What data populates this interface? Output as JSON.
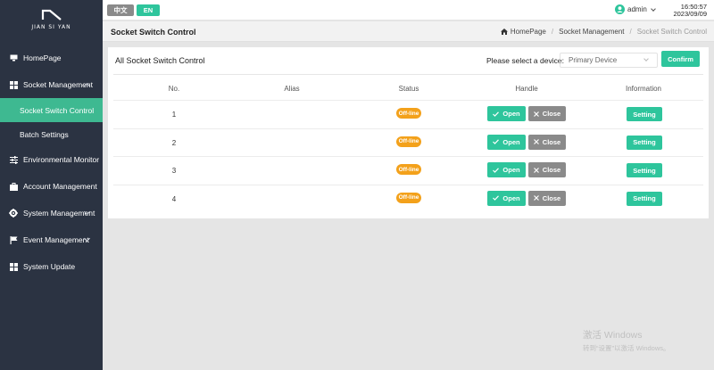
{
  "brand": {
    "logo_text": "JIAN SI YAN"
  },
  "sidebar": {
    "items": [
      {
        "label": "HomePage",
        "icon": "monitor-icon"
      },
      {
        "label": "Socket Management",
        "icon": "grid-icon",
        "expanded": true,
        "children": [
          {
            "label": "Socket Switch Control",
            "active": true
          },
          {
            "label": "Batch Settings"
          }
        ]
      },
      {
        "label": "Environmental Monitor",
        "icon": "sliders-icon"
      },
      {
        "label": "Account Management",
        "icon": "briefcase-icon"
      },
      {
        "label": "System Management",
        "icon": "gear-icon"
      },
      {
        "label": "Event Management",
        "icon": "flag-icon"
      },
      {
        "label": "System Update",
        "icon": "grid-icon"
      }
    ]
  },
  "topbar": {
    "lang_zh": "中文",
    "lang_en": "EN",
    "user": "admin",
    "time": "16:50:57",
    "date": "2023/09/09"
  },
  "header": {
    "title": "Socket Switch Control",
    "breadcrumb": [
      "HomePage",
      "Socket Management",
      "Socket Switch Control"
    ]
  },
  "card": {
    "title": "All Socket Switch Control",
    "device_label": "Please select a device:",
    "device_selected": "Primary Device",
    "confirm_label": "Confirm"
  },
  "table": {
    "columns": [
      "No.",
      "Alias",
      "Status",
      "Handle",
      "Information"
    ],
    "rows": [
      {
        "no": "1",
        "alias": "",
        "status": "Off-line"
      },
      {
        "no": "2",
        "alias": "",
        "status": "Off-line"
      },
      {
        "no": "3",
        "alias": "",
        "status": "Off-line"
      },
      {
        "no": "4",
        "alias": "",
        "status": "Off-line"
      }
    ],
    "open_label": "Open",
    "close_label": "Close",
    "setting_label": "Setting"
  },
  "watermark": {
    "line1": "激活 Windows",
    "line2": "转到“设置”以激活 Windows。"
  },
  "colors": {
    "sidebar_bg": "#2b3342",
    "accent": "#2ec59c",
    "status_offline": "#f3a11b",
    "close_btn": "#8a8a8a"
  }
}
